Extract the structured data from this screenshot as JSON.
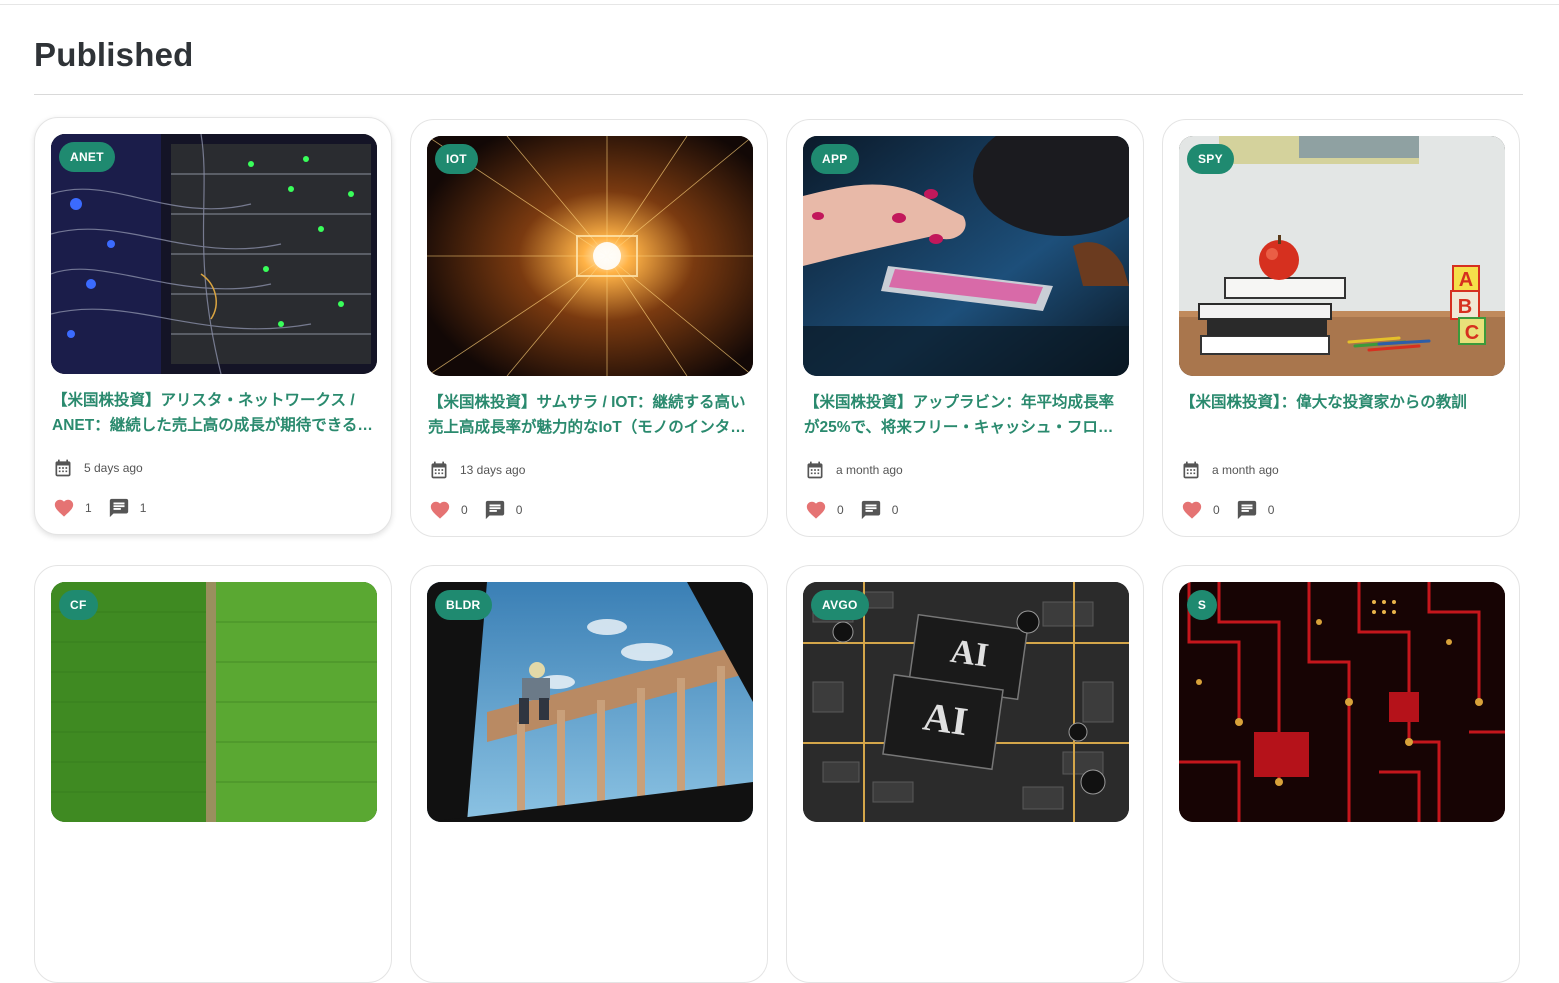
{
  "page": {
    "title": "Published"
  },
  "colors": {
    "accent": "#1f8a70",
    "title_text": "#2a8a6e",
    "heart": "#e57373",
    "icon": "#555555"
  },
  "cards": [
    {
      "ticker": "ANET",
      "title": "【米国株投資】アリスタ・ネットワークス / ANET：継続した売上高の成長が期待できるネットワーク機器メーカー",
      "date": "5 days ago",
      "likes": "1",
      "comments": "1",
      "image": "server-rack-cables"
    },
    {
      "ticker": "IOT",
      "title": "【米国株投資】サムサラ / IOT：継続する高い売上高成長率が魅力的なIoT（モノのインターネット）企業",
      "date": "13 days ago",
      "likes": "0",
      "comments": "0",
      "image": "light-tunnel"
    },
    {
      "ticker": "APP",
      "title": "【米国株投資】アップラビン：年平均成長率が25%で、将来フリー・キャッシュ・フローの成長が期待できる企業",
      "date": "a month ago",
      "likes": "0",
      "comments": "0",
      "image": "hand-on-smartphone"
    },
    {
      "ticker": "SPY",
      "title": "【米国株投資】：偉大な投資家からの教訓",
      "date": "a month ago",
      "likes": "0",
      "comments": "0",
      "image": "apple-on-books"
    },
    {
      "ticker": "CF",
      "title": "",
      "date": "",
      "likes": "",
      "comments": "",
      "image": "green-field"
    },
    {
      "ticker": "BLDR",
      "title": "",
      "date": "",
      "likes": "",
      "comments": "",
      "image": "construction-worker-frame"
    },
    {
      "ticker": "AVGO",
      "title": "",
      "date": "",
      "likes": "",
      "comments": "",
      "image": "ai-chip-board"
    },
    {
      "ticker": "S",
      "title": "",
      "date": "",
      "likes": "",
      "comments": "",
      "image": "red-circuit-board"
    }
  ]
}
